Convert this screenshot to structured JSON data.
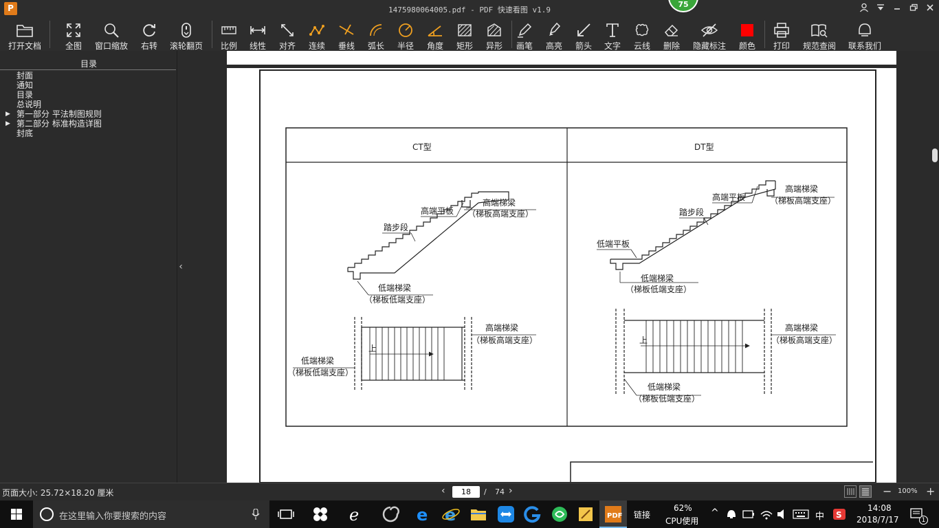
{
  "window": {
    "title": "1475980064005.pdf - PDF 快速看图 v1.9",
    "logo_letter": "P",
    "score_badge": "75"
  },
  "toolbar": {
    "items": [
      {
        "label": "打开文档",
        "icon": "folder-icon"
      },
      {
        "label": "全图",
        "icon": "fit-all-icon"
      },
      {
        "label": "窗口缩放",
        "icon": "zoom-window-icon"
      },
      {
        "label": "右转",
        "icon": "rotate-right-icon"
      },
      {
        "label": "滚轮翻页",
        "icon": "mouse-wheel-icon"
      },
      {
        "label": "比例",
        "icon": "scale-icon"
      },
      {
        "label": "线性",
        "icon": "linear-dimension-icon"
      },
      {
        "label": "对齐",
        "icon": "aligned-dimension-icon"
      },
      {
        "label": "连续",
        "icon": "continuous-dimension-icon"
      },
      {
        "label": "垂线",
        "icon": "perpendicular-icon"
      },
      {
        "label": "弧长",
        "icon": "arc-length-icon"
      },
      {
        "label": "半径",
        "icon": "radius-icon"
      },
      {
        "label": "角度",
        "icon": "angle-icon"
      },
      {
        "label": "矩形",
        "icon": "rectangle-area-icon"
      },
      {
        "label": "异形",
        "icon": "irregular-area-icon"
      },
      {
        "label": "画笔",
        "icon": "pencil-icon"
      },
      {
        "label": "高亮",
        "icon": "highlighter-icon"
      },
      {
        "label": "箭头",
        "icon": "arrow-icon"
      },
      {
        "label": "文字",
        "icon": "text-icon"
      },
      {
        "label": "云线",
        "icon": "cloud-line-icon"
      },
      {
        "label": "删除",
        "icon": "eraser-icon"
      },
      {
        "label": "隐藏标注",
        "icon": "hide-annotations-icon"
      },
      {
        "label": "颜色",
        "icon": "color-swatch-icon"
      },
      {
        "label": "打印",
        "icon": "printer-icon"
      },
      {
        "label": "规范查阅",
        "icon": "standards-book-icon"
      },
      {
        "label": "联系我们",
        "icon": "contact-icon"
      }
    ],
    "color_swatch": "#ff0000"
  },
  "sidebar": {
    "title": "目录",
    "items": [
      {
        "label": "封面",
        "expandable": false
      },
      {
        "label": "通知",
        "expandable": false
      },
      {
        "label": "目录",
        "expandable": false
      },
      {
        "label": "总说明",
        "expandable": false
      },
      {
        "label": "第一部分 平法制图规则",
        "expandable": true
      },
      {
        "label": "第二部分 标准构造详图",
        "expandable": true
      },
      {
        "label": "封底",
        "expandable": false
      }
    ]
  },
  "drawing": {
    "left_header": "CT型",
    "right_header": "DT型",
    "ct": {
      "high_platform": "高端平板",
      "high_beam": "高端梯梁",
      "high_support": "（梯板高端支座）",
      "steps": "踏步段",
      "low_beam": "低端梯梁",
      "low_support": "（梯板低端支座）",
      "plan_high_beam": "高端梯梁",
      "plan_high_support": "（梯板高端支座）",
      "plan_low_beam": "低端梯梁",
      "plan_low_support": "（梯板低端支座）",
      "up_label": "上"
    },
    "dt": {
      "high_platform": "高端平板",
      "high_beam": "高端梯梁",
      "high_support": "（梯板高端支座）",
      "steps": "踏步段",
      "low_platform": "低端平板",
      "low_beam": "低端梯梁",
      "low_support": "（梯板低端支座）",
      "plan_high_beam": "高端梯梁",
      "plan_high_support": "（梯板高端支座）",
      "plan_low_beam": "低端梯梁",
      "plan_low_support": "（梯板低端支座）",
      "up_label": "上"
    }
  },
  "statusbar": {
    "page_size": "页面大小: 25.72×18.20 厘米",
    "current_page": "18",
    "separator": "/",
    "total_pages": "74",
    "zoom": "100%"
  },
  "taskbar": {
    "search_placeholder": "在这里输入你要搜索的内容",
    "link_label": "链接",
    "cpu_percent": "62%",
    "cpu_label": "CPU使用",
    "ime": "中",
    "time": "14:08",
    "date": "2018/7/17",
    "notification_count": "1"
  }
}
